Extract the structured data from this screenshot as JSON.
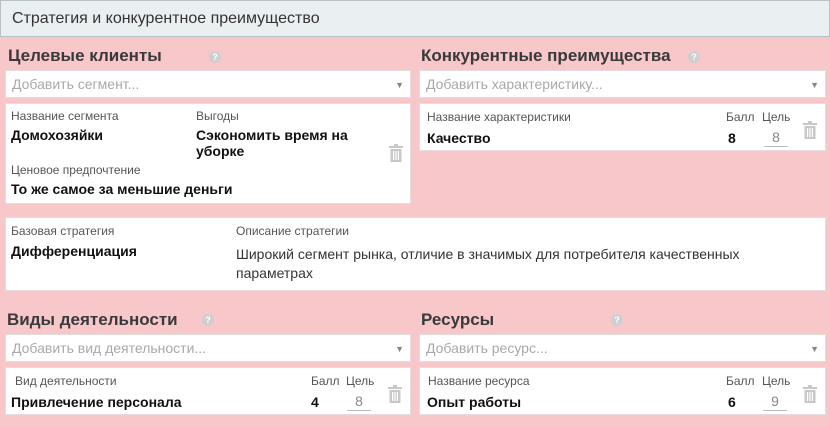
{
  "header": {
    "title": "Стратегия и конкурентное преимущество"
  },
  "target_clients": {
    "title": "Целевые клиенты",
    "select_placeholder": "Добавить сегмент...",
    "card": {
      "segment_label": "Название сегмента",
      "segment_value": "Домохозяйки",
      "benefits_label": "Выгоды",
      "benefits_value_line1": "Сэкономить время на",
      "benefits_value_line2": "уборке",
      "price_label": "Ценовое предпочтение",
      "price_value": "То же самое за меньшие деньги"
    }
  },
  "competitive_advantages": {
    "title": "Конкурентные преимущества",
    "select_placeholder": "Добавить характеристику...",
    "card": {
      "name_label": "Название характеристики",
      "score_label": "Балл",
      "goal_label": "Цель",
      "name_value": "Качество",
      "score_value": "8",
      "goal_value": "8"
    }
  },
  "strategy": {
    "base_label": "Базовая стратегия",
    "base_value": "Дифференциация",
    "desc_label": "Описание стратегии",
    "desc_line1": "Широкий сегмент рынка, отличие в значимых для потребителя качественных",
    "desc_line2": "параметрах"
  },
  "activities": {
    "title": "Виды деятельности",
    "select_placeholder": "Добавить вид деятельности...",
    "card": {
      "name_label": "Вид деятельности",
      "score_label": "Балл",
      "goal_label": "Цель",
      "name_value": "Привлечение персонала",
      "score_value": "4",
      "goal_value": "8"
    }
  },
  "resources": {
    "title": "Ресурсы",
    "select_placeholder": "Добавить ресурс...",
    "card": {
      "name_label": "Название ресурса",
      "score_label": "Балл",
      "goal_label": "Цель",
      "name_value": "Опыт работы",
      "score_value": "6",
      "goal_value": "9"
    }
  },
  "icons": {
    "help": "help-circle-icon",
    "trash": "trash-icon",
    "caret": "chevron-down-icon"
  },
  "help_glyph": "?",
  "caret_glyph": "▼"
}
